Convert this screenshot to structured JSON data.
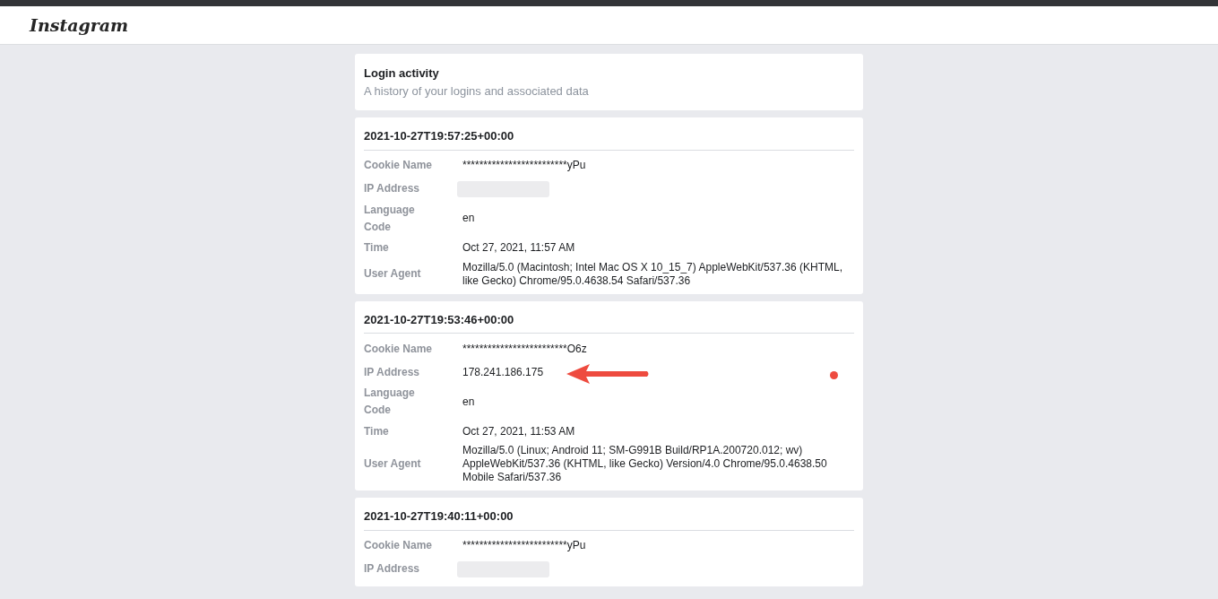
{
  "header": {
    "logo": "Instagram"
  },
  "intro": {
    "title": "Login activity",
    "subtitle": "A history of your logins and associated data"
  },
  "entries": [
    {
      "timestamp": "2021-10-27T19:57:25+00:00",
      "fields": [
        {
          "label": "Cookie Name",
          "kind": "text",
          "value": "*************************yPu",
          "highlighted": false
        },
        {
          "label": "IP Address",
          "kind": "redacted",
          "highlighted": false
        },
        {
          "label": "Language Code",
          "kind": "text",
          "value": "en",
          "highlighted": false
        },
        {
          "label": "Time",
          "kind": "text",
          "value": "Oct 27, 2021, 11:57 AM",
          "highlighted": false
        },
        {
          "label": "User Agent",
          "kind": "text",
          "value": "Mozilla/5.0 (Macintosh; Intel Mac OS X 10_15_7) AppleWebKit/537.36 (KHTML, like Gecko) Chrome/95.0.4638.54 Safari/537.36",
          "highlighted": false
        }
      ]
    },
    {
      "timestamp": "2021-10-27T19:53:46+00:00",
      "fields": [
        {
          "label": "Cookie Name",
          "kind": "text",
          "value": "*************************O6z",
          "highlighted": false
        },
        {
          "label": "IP Address",
          "kind": "text",
          "value": "178.241.186.175",
          "highlighted": true
        },
        {
          "label": "Language Code",
          "kind": "text",
          "value": "en",
          "highlighted": false
        },
        {
          "label": "Time",
          "kind": "text",
          "value": "Oct 27, 2021, 11:53 AM",
          "highlighted": false
        },
        {
          "label": "User Agent",
          "kind": "text",
          "value": "Mozilla/5.0 (Linux; Android 11; SM-G991B Build/RP1A.200720.012; wv) AppleWebKit/537.36 (KHTML, like Gecko) Version/4.0 Chrome/95.0.4638.50 Mobile Safari/537.36",
          "highlighted": false
        }
      ]
    },
    {
      "timestamp": "2021-10-27T19:40:11+00:00",
      "fields": [
        {
          "label": "Cookie Name",
          "kind": "text",
          "value": "*************************yPu",
          "highlighted": false
        },
        {
          "label": "IP Address",
          "kind": "redacted",
          "highlighted": false
        }
      ]
    }
  ]
}
